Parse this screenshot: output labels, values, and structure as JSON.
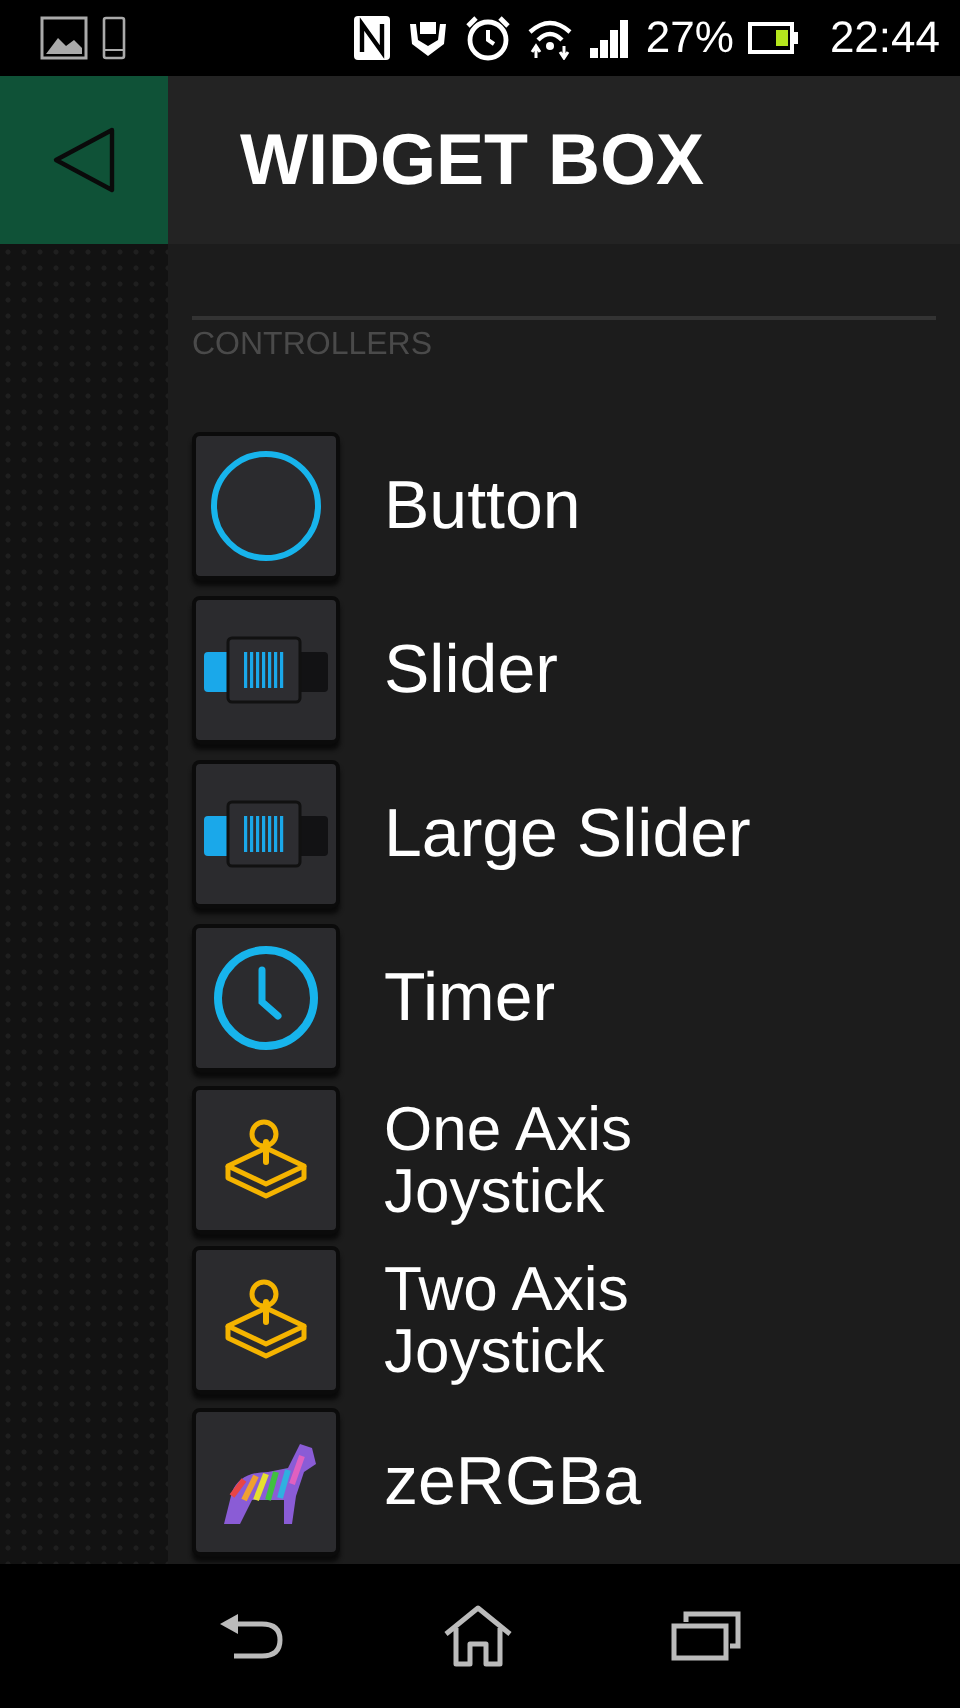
{
  "status_bar": {
    "battery": "27%",
    "time": "22:44"
  },
  "header": {
    "title": "WIDGET BOX"
  },
  "section": {
    "title": "CONTROLLERS"
  },
  "widgets": [
    {
      "label": "Button",
      "kind": "button"
    },
    {
      "label": "Slider",
      "kind": "slider"
    },
    {
      "label": "Large Slider",
      "kind": "slider"
    },
    {
      "label": "Timer",
      "kind": "timer"
    },
    {
      "label": "One Axis Joystick",
      "kind": "joystick"
    },
    {
      "label": "Two Axis Joystick",
      "kind": "joystick"
    },
    {
      "label": "zeRGBa",
      "kind": "zergba"
    }
  ]
}
